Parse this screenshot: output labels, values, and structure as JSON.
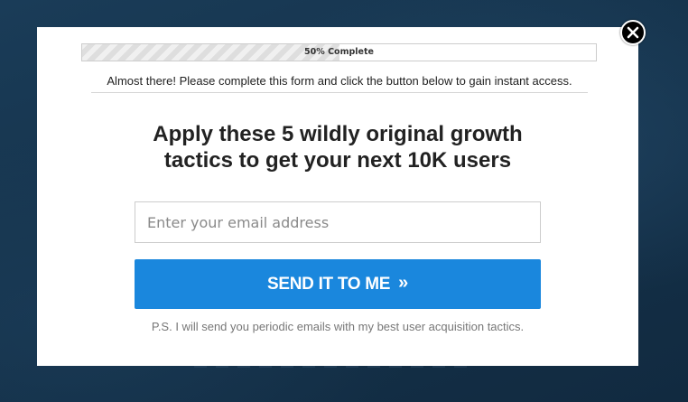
{
  "progress": {
    "label": "50% Complete",
    "percent": 50
  },
  "modal": {
    "subline": "Almost there! Please complete this form and click the button below to gain instant access.",
    "headline_line1": "Apply these 5 wildly original growth",
    "headline_line2": "tactics to get your next 10K users",
    "email_placeholder": "Enter your email address",
    "email_value": "",
    "submit_label": "SEND IT TO ME",
    "submit_chevron": "»",
    "ps_note": "P.S. I will send you periodic emails with my best user acquisition tactics."
  },
  "icons": {
    "close": "close-icon",
    "chevron": "double-chevron-right-icon"
  },
  "colors": {
    "backdrop": "#14334d",
    "button": "#1a87dd",
    "modal_bg": "#ffffff"
  }
}
